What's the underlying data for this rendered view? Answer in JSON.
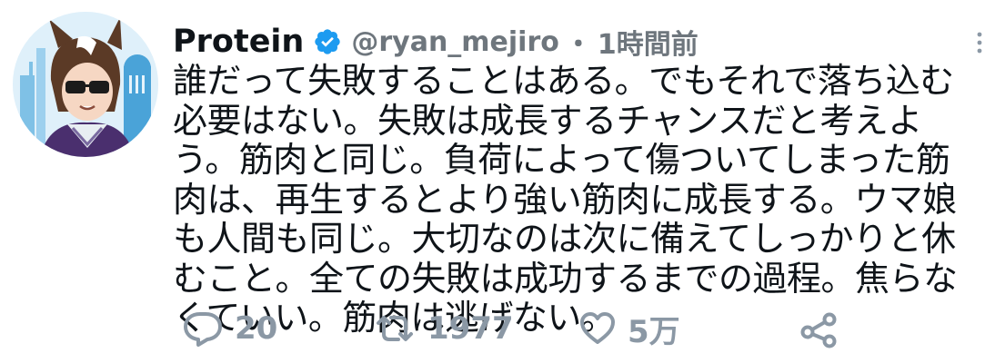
{
  "tweet": {
    "author": {
      "display_name": "Protein",
      "handle": "@ryan_mejiro",
      "verified": true,
      "avatar_icon": "avatar-image"
    },
    "separator": "・",
    "time": "1時間前",
    "text": "誰だって失敗することはある。でもそれで落ち込む必要はない。失敗は成長するチャンスだと考えよう。筋肉と同じ。負荷によって傷ついてしまった筋肉は、再生するとより強い筋肉に成長する。ウマ娘も人間も同じ。大切なのは次に備えてしっかりと休むこと。全ての失敗は成功するまでの過程。焦らなくていい。筋肉は逃げない。",
    "stats": {
      "replies": "20",
      "retweets": "1977",
      "likes": "5万"
    }
  },
  "colors": {
    "text": "#0f1419",
    "secondary": "#6e767d",
    "action": "#8b98a5",
    "verified": "#1d9bf0"
  },
  "icons": {
    "verified": "verified-badge-icon",
    "more": "more-vertical-icon",
    "reply": "reply-bubble-icon",
    "retweet": "retweet-icon",
    "like": "heart-icon",
    "share": "share-icon"
  }
}
